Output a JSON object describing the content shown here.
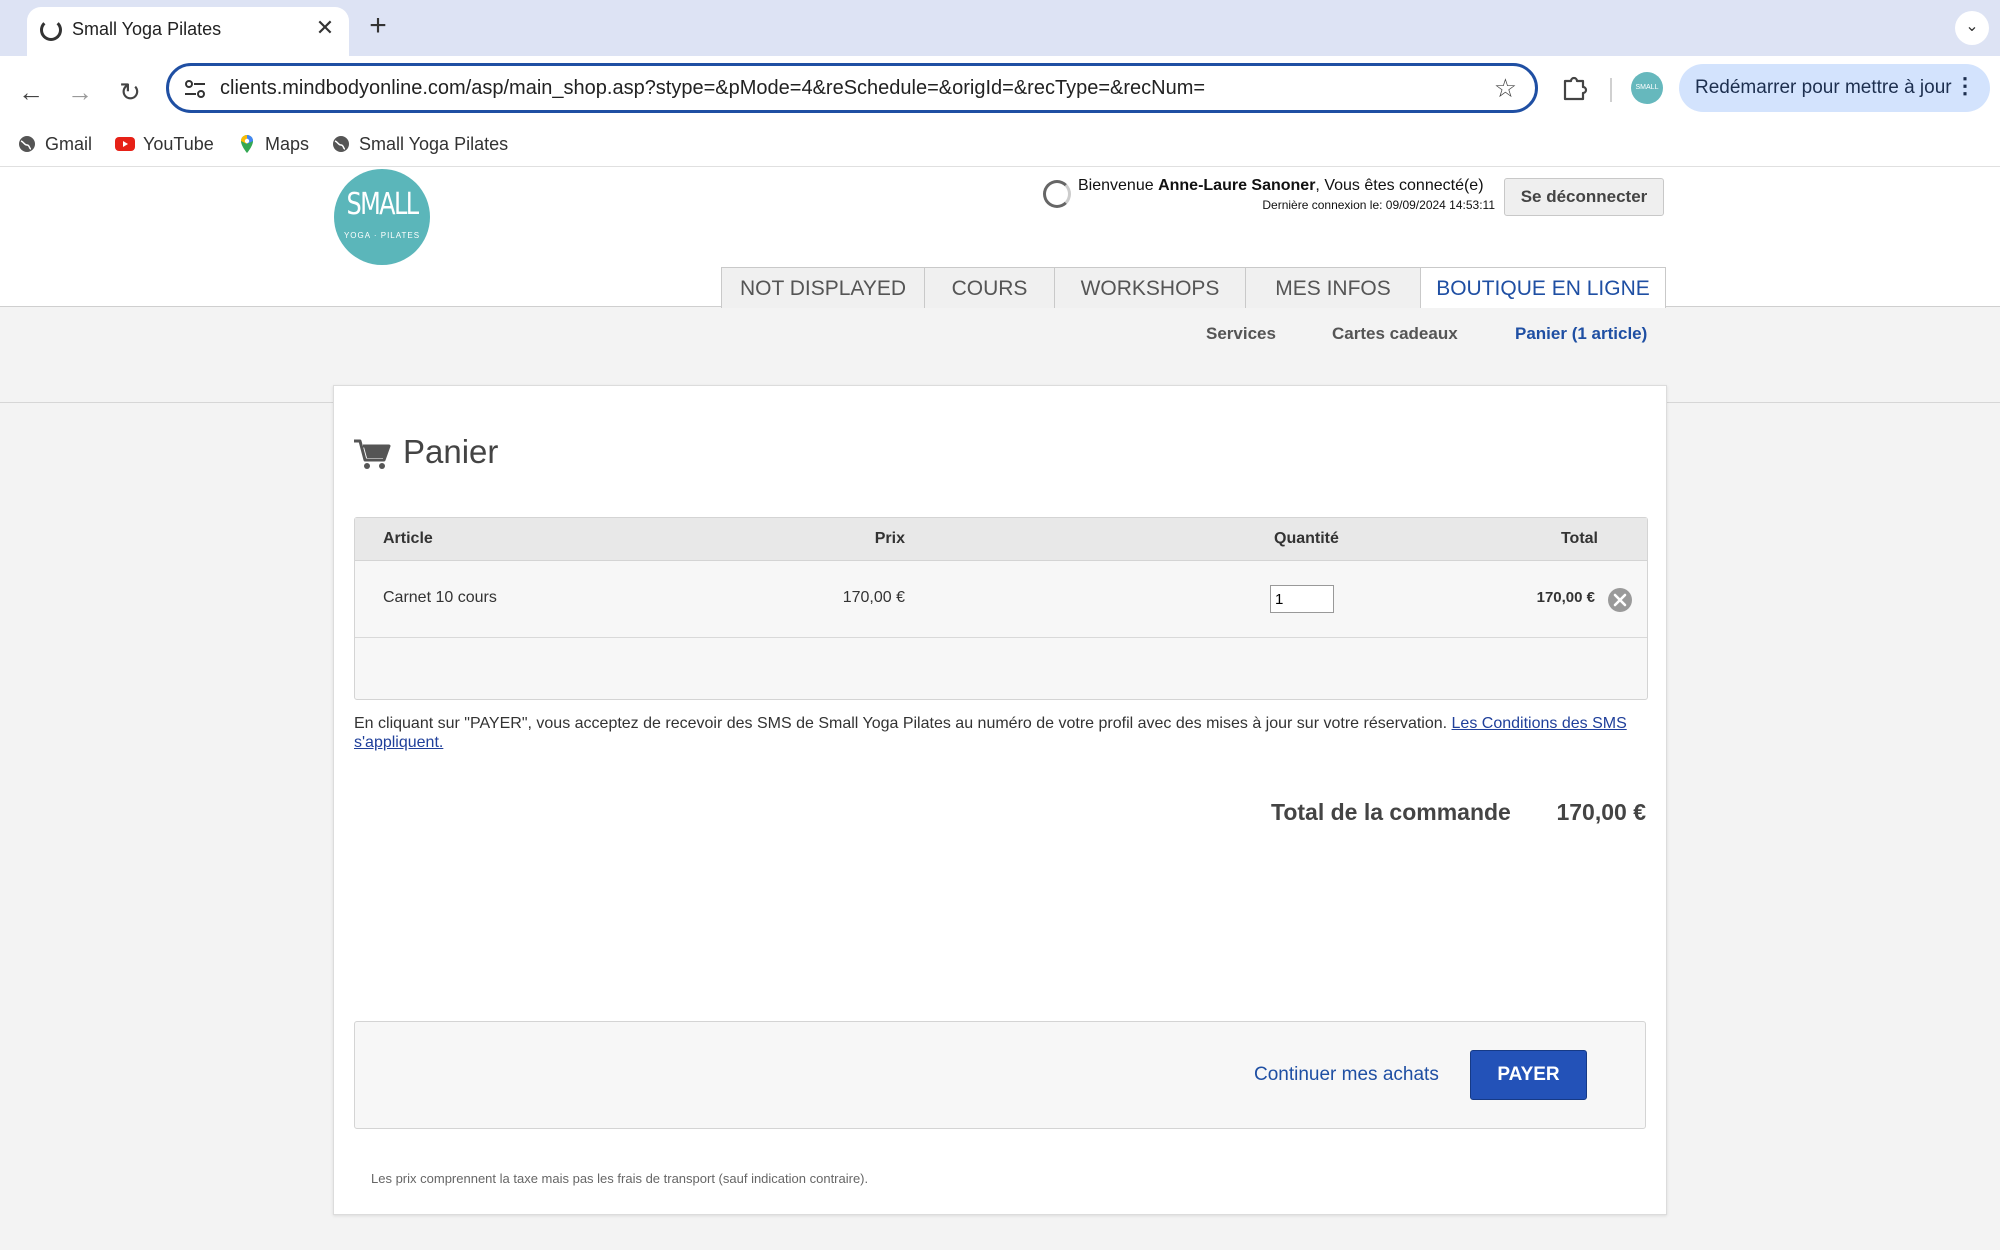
{
  "browser": {
    "tab_title": "Small Yoga Pilates",
    "new_tab": "+",
    "url": "clients.mindbodyonline.com/asp/main_shop.asp?stype=&pMode=4&reSchedule=&origId=&recType=&recNum=",
    "update_button": "Redémarrer pour mettre à jour",
    "profile_initials": "SMALL",
    "bookmarks": [
      {
        "label": "Gmail",
        "icon": "globe-icon"
      },
      {
        "label": "YouTube",
        "icon": "youtube-icon"
      },
      {
        "label": "Maps",
        "icon": "maps-pin-icon"
      },
      {
        "label": "Small Yoga Pilates",
        "icon": "globe-icon"
      }
    ]
  },
  "header": {
    "logo_big": "SMALL",
    "logo_small": "YOGA · PILATES",
    "welcome_prefix": "Bienvenue ",
    "user_name": "Anne-Laure Sanoner",
    "welcome_suffix": ", Vous êtes connecté(e)",
    "last_login": "Dernière connexion le: 09/09/2024 14:53:11",
    "logout_label": "Se déconnecter"
  },
  "nav": {
    "tabs": [
      {
        "label": "NOT DISPLAYED",
        "active": false
      },
      {
        "label": "COURS",
        "active": false
      },
      {
        "label": "WORKSHOPS",
        "active": false
      },
      {
        "label": "MES INFOS",
        "active": false
      },
      {
        "label": "BOUTIQUE EN LIGNE",
        "active": true
      }
    ],
    "subnav": [
      {
        "label": "Services",
        "active": false
      },
      {
        "label": "Cartes cadeaux",
        "active": false
      },
      {
        "label": "Panier (1 article)",
        "active": true
      }
    ]
  },
  "cart": {
    "title": "Panier",
    "columns": {
      "article": "Article",
      "price": "Prix",
      "quantity": "Quantité",
      "total": "Total"
    },
    "items": [
      {
        "article": "Carnet 10 cours",
        "price": "170,00 €",
        "quantity": "1",
        "total": "170,00 €"
      }
    ],
    "sms_notice": "En cliquant sur \"PAYER\", vous acceptez de recevoir des SMS de Small Yoga Pilates au numéro de votre profil avec des mises à jour sur votre réservation. ",
    "sms_link": "Les Conditions des SMS s'appliquent.",
    "order_total_label": "Total de la commande",
    "order_total_value": "170,00 €",
    "continue_label": "Continuer mes achats",
    "pay_label": "PAYER",
    "footnote": "Les prix comprennent la taxe mais pas les frais de transport (sauf indication contraire)."
  },
  "colors": {
    "accent": "#1f4fa3",
    "pay_button": "#2352b8",
    "logo": "#5bb6ba",
    "tabstrip": "#dde3f4"
  }
}
